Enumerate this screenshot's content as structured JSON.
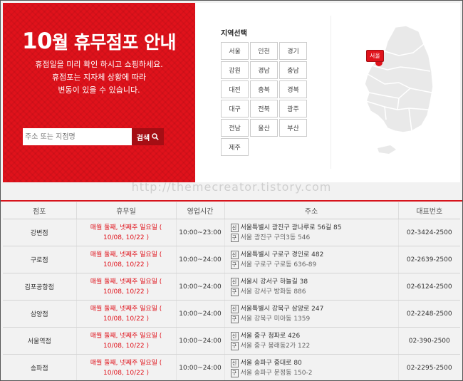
{
  "hero": {
    "title_num": "10",
    "title_rest": "월 휴무점포 안내",
    "desc": [
      "휴점일을 미리 확인 하시고 쇼핑하세요.",
      "휴점포는 지자체 상황에 따라",
      "변동이 있을 수 있습니다."
    ],
    "search_placeholder": "주소 또는 지점명",
    "search_button": "검색"
  },
  "region": {
    "title": "지역선택",
    "items": [
      "서울",
      "인천",
      "경기",
      "강원",
      "경남",
      "충남",
      "대전",
      "충북",
      "경북",
      "대구",
      "전북",
      "광주",
      "전남",
      "울산",
      "부산",
      "제주"
    ],
    "map_marker": "서울"
  },
  "watermark": "http://themecreator.tistory.com",
  "table": {
    "headers": [
      "점포",
      "휴무일",
      "영업시간",
      "주소",
      "대표번호"
    ],
    "rows": [
      {
        "store": "강변점",
        "holiday1": "매월 둘째, 넷째주 일요일 (",
        "holiday2": "10/08, 10/22 )",
        "hours": "10:00~23:00",
        "addr_new": "서울특별시 광진구 광나루로 56길 85",
        "addr_old": "서울 광진구 구의3동 546",
        "phone": "02-3424-2500"
      },
      {
        "store": "구로점",
        "holiday1": "매월 둘째, 넷째주 일요일 (",
        "holiday2": "10/08, 10/22 )",
        "hours": "10:00~24:00",
        "addr_new": "서울특별시 구로구 경인로 482",
        "addr_old": "서울 구로구 구로동 636-89",
        "phone": "02-2639-2500"
      },
      {
        "store": "김포공항점",
        "holiday1": "매월 둘째, 넷째주 일요일 (",
        "holiday2": "10/08, 10/22 )",
        "hours": "10:00~24:00",
        "addr_new": "서울시 강서구 하늘길 38",
        "addr_old": "서울 강서구 방화동 886",
        "phone": "02-6124-2500"
      },
      {
        "store": "삼양점",
        "holiday1": "매월 둘째, 넷째주 일요일 (",
        "holiday2": "10/08, 10/22 )",
        "hours": "10:00~24:00",
        "addr_new": "서울특별시 강북구 삼양로 247",
        "addr_old": "서울 강북구 미아동 1359",
        "phone": "02-2248-2500"
      },
      {
        "store": "서울역점",
        "holiday1": "매월 둘째, 넷째주 일요일 (",
        "holiday2": "10/08, 10/22 )",
        "hours": "10:00~24:00",
        "addr_new": "서울 중구 청파로 426",
        "addr_old": "서울 중구 봉래동2가 122",
        "phone": "02-390-2500"
      },
      {
        "store": "송파점",
        "holiday1": "매월 둘째, 넷째주 일요일 (",
        "holiday2": "10/08, 10/22 )",
        "hours": "10:00~24:00",
        "addr_new": "서울 송파구 중대로 80",
        "addr_old": "서울 송파구 문정동 150-2",
        "phone": "02-2295-2500"
      }
    ],
    "tag_new": "신",
    "tag_old": "구"
  },
  "colors": {
    "brand_red": "#e0121b",
    "button_dark_red": "#a50e14",
    "holiday_text": "#e0121b"
  }
}
